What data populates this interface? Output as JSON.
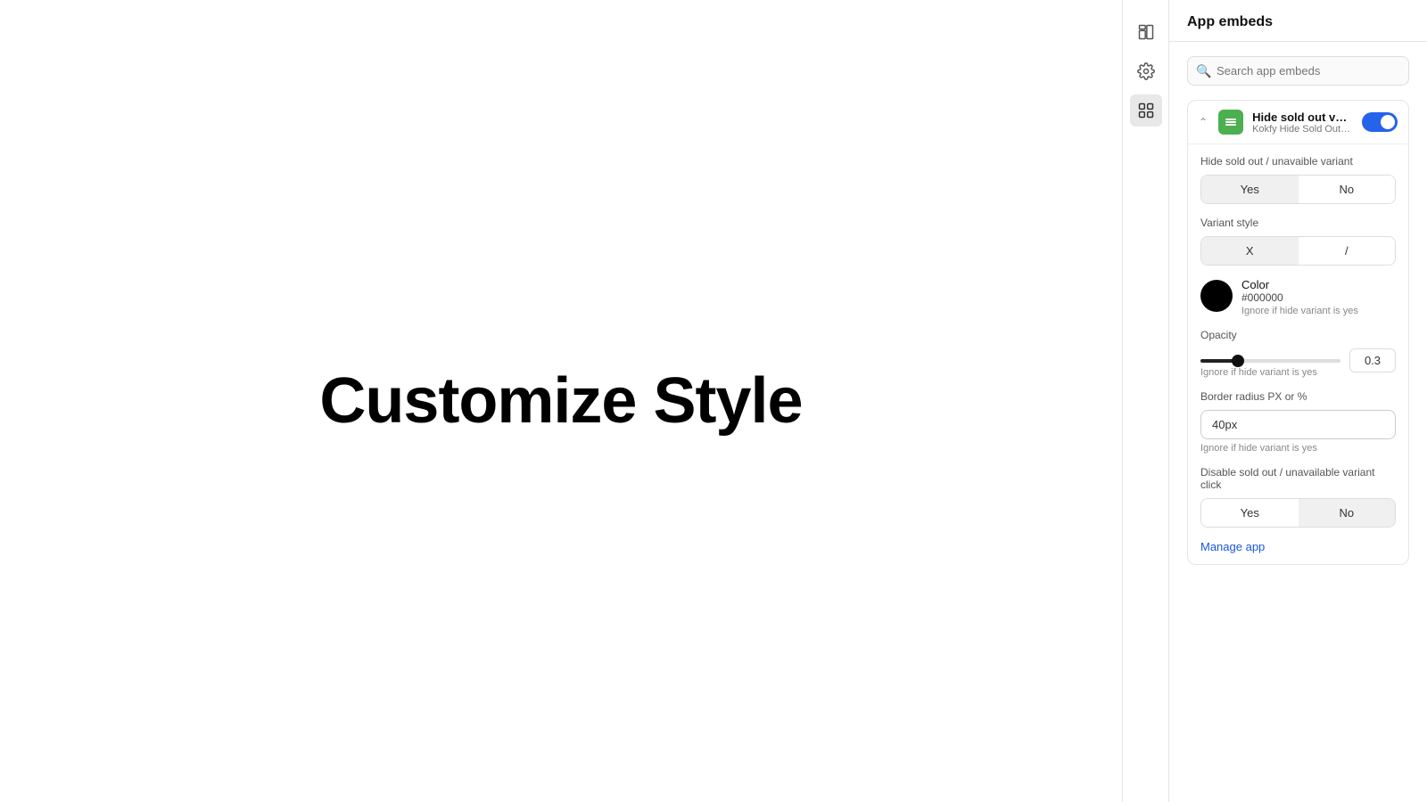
{
  "main": {
    "title": "Customize Style"
  },
  "toolbar": {
    "icons": [
      {
        "name": "layout-icon",
        "label": "Layout",
        "active": false
      },
      {
        "name": "settings-icon",
        "label": "Settings",
        "active": false
      },
      {
        "name": "apps-icon",
        "label": "App embeds",
        "active": true
      }
    ]
  },
  "panel": {
    "title": "App embeds",
    "search": {
      "placeholder": "Search app embeds"
    },
    "embed": {
      "name": "Hide sold out variant",
      "subtitle": "Kokfy Hide Sold Out Varia...",
      "toggle_on": true,
      "fields": {
        "hide_label": "Hide sold out / unavaible variant",
        "hide_yes": "Yes",
        "hide_no": "No",
        "hide_active": "yes",
        "variant_style_label": "Variant style",
        "variant_x": "X",
        "variant_slash": "/",
        "variant_active": "X",
        "color_label": "Color",
        "color_hex": "#000000",
        "color_note": "Ignore if hide variant is yes",
        "opacity_label": "Opacity",
        "opacity_value": "0.3",
        "opacity_note": "Ignore if hide variant is yes",
        "border_label": "Border radius PX or %",
        "border_value": "40px",
        "border_note": "Ignore if hide variant is yes",
        "disable_label": "Disable sold out / unavailable variant click",
        "disable_yes": "Yes",
        "disable_no": "No",
        "disable_active": "no"
      }
    },
    "manage_link": "Manage app"
  }
}
